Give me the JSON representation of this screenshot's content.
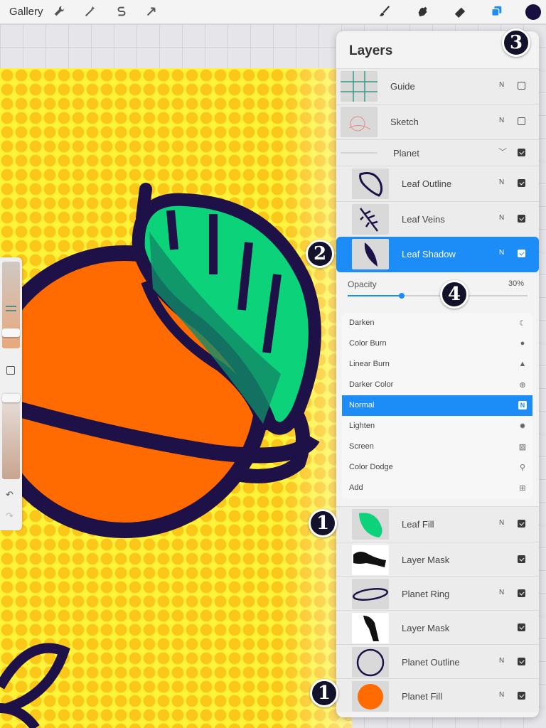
{
  "toolbar": {
    "gallery_label": "Gallery",
    "left_tools": [
      "wrench-icon",
      "magic-wand-icon",
      "selection-s-icon",
      "transform-arrow-icon"
    ],
    "right_tools": [
      "brush-icon",
      "smudge-icon",
      "eraser-icon",
      "layers-icon"
    ],
    "current_color": "#16103f",
    "accent": "#1c8cf7"
  },
  "layers_panel": {
    "title": "Layers",
    "layers": [
      {
        "name": "Guide",
        "mode": "N",
        "visible": false
      },
      {
        "name": "Sketch",
        "mode": "N",
        "visible": false
      },
      {
        "name": "Planet",
        "group": true,
        "visible": true
      },
      {
        "name": "Leaf Outline",
        "mode": "N",
        "visible": true
      },
      {
        "name": "Leaf Veins",
        "mode": "N",
        "visible": true
      },
      {
        "name": "Leaf Shadow",
        "mode": "N",
        "visible": true,
        "selected": true
      },
      {
        "name": "Leaf Fill",
        "mode": "N",
        "visible": true
      },
      {
        "name": "Layer Mask",
        "mode": "",
        "visible": true
      },
      {
        "name": "Planet Ring",
        "mode": "N",
        "visible": true
      },
      {
        "name": "Layer Mask",
        "mode": "",
        "visible": true
      },
      {
        "name": "Planet Outline",
        "mode": "N",
        "visible": true
      },
      {
        "name": "Planet Fill",
        "mode": "N",
        "visible": true
      }
    ],
    "opacity": {
      "label": "Opacity",
      "value_text": "30%",
      "value": 30
    },
    "blend_modes": [
      {
        "name": "Darken",
        "icon": "moon-icon"
      },
      {
        "name": "Color Burn",
        "icon": "burn-icon"
      },
      {
        "name": "Linear Burn",
        "icon": "flame-icon"
      },
      {
        "name": "Darker Color",
        "icon": "plus-circle-icon"
      },
      {
        "name": "Normal",
        "icon": "n-badge-icon",
        "active": true,
        "badge": "N"
      },
      {
        "name": "Lighten",
        "icon": "sun-icon"
      },
      {
        "name": "Screen",
        "icon": "stripes-icon"
      },
      {
        "name": "Color Dodge",
        "icon": "dodge-icon"
      },
      {
        "name": "Add",
        "icon": "plus-square-icon"
      }
    ]
  },
  "callouts": [
    "3",
    "2",
    "4",
    "1",
    "1"
  ]
}
